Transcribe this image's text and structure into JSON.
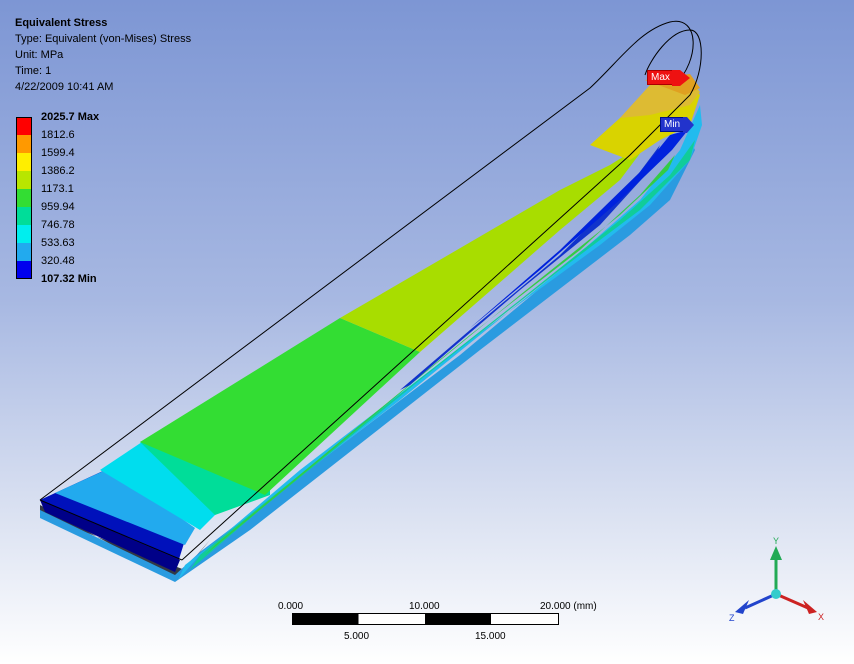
{
  "info": {
    "title": "Equivalent Stress",
    "type": "Type: Equivalent (von-Mises) Stress",
    "unit": "Unit: MPa",
    "time": "Time: 1",
    "date": "4/22/2009 10:41 AM"
  },
  "legend": {
    "max_label": "2025.7 Max",
    "values": [
      "1812.6",
      "1599.4",
      "1386.2",
      "1173.1",
      "959.94",
      "746.78",
      "533.63",
      "320.48"
    ],
    "min_label": "107.32 Min",
    "colors": [
      "#ff0000",
      "#ff9900",
      "#ffee00",
      "#b8e600",
      "#33dd33",
      "#00dd99",
      "#00eeee",
      "#22aaee",
      "#0000ee"
    ]
  },
  "markers": {
    "max": "Max",
    "min": "Min",
    "max_color": "#ee1111",
    "min_color": "#2233cc"
  },
  "scale_bar": {
    "top_labels": [
      "0.000",
      "10.000",
      "20.000 (mm)"
    ],
    "bottom_labels": [
      "5.000",
      "15.000"
    ]
  },
  "triad": {
    "x": "X",
    "y": "Y",
    "z": "Z",
    "x_color": "#cc2222",
    "y_color": "#22aa55",
    "z_color": "#2244cc"
  }
}
